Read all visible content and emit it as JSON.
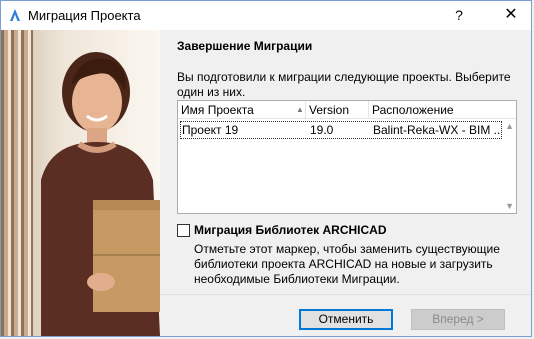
{
  "window": {
    "title": "Миграция Проекта",
    "help": "?",
    "close": "✕"
  },
  "main": {
    "section_title": "Завершение Миграции",
    "description": "Вы подготовили к миграции следующие проекты. Выберите один из них.",
    "table": {
      "columns": [
        "Имя Проекта",
        "Version",
        "Расположение"
      ],
      "rows": [
        [
          "Проект 19",
          "19.0",
          "Balint-Reka-WX - BIM ..."
        ]
      ]
    },
    "library": {
      "checkbox_label": "Миграция Библиотек ARCHICAD",
      "checked": false,
      "description": "Отметьте этот маркер, чтобы заменить существующие библиотеки проекта ARCHICAD на новые и загрузить необходимые Библиотеки Миграции."
    }
  },
  "buttons": {
    "cancel": "Отменить",
    "next": "Вперед >"
  },
  "colors": {
    "accent": "#0078d7",
    "panel_bg": "#f0f0f0"
  }
}
